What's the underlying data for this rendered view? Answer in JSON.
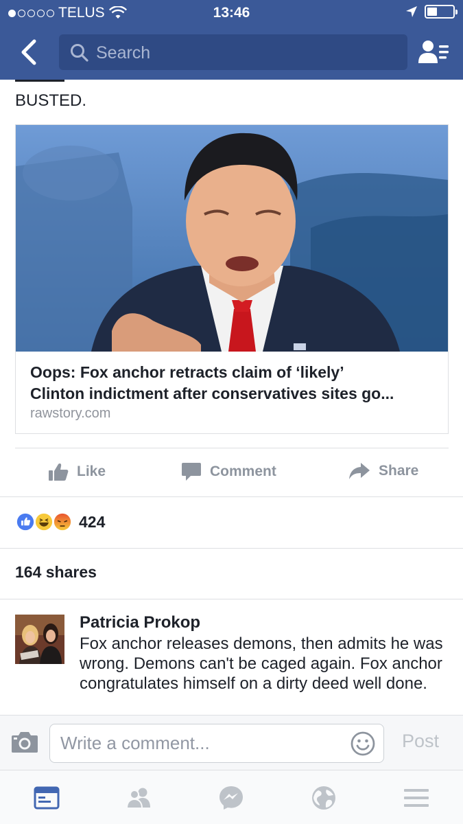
{
  "status_bar": {
    "carrier": "TELUS",
    "time": "13:46"
  },
  "header": {
    "search_placeholder": "Search"
  },
  "post": {
    "text": "BUSTED.",
    "link": {
      "title_line1": "Oops: Fox anchor retracts claim of ‘likely’",
      "title_line2": "Clinton indictment after conservatives sites go...",
      "domain": "rawstory.com"
    },
    "actions": {
      "like": "Like",
      "comment": "Comment",
      "share": "Share"
    },
    "reactions": {
      "icons": [
        "like-reaction-icon",
        "haha-reaction-icon",
        "angry-reaction-icon"
      ],
      "count": "424"
    },
    "shares": "164 shares"
  },
  "comment": {
    "author": "Patricia Prokop",
    "text": "Fox anchor releases demons, then admits he was wrong. Demons can't be caged again. Fox anchor congratulates himself on a dirty deed well done."
  },
  "composer": {
    "placeholder": "Write a comment...",
    "post_label": "Post"
  },
  "tab_bar": {
    "tabs": [
      "news-feed-icon",
      "friends-icon",
      "messenger-icon",
      "globe-icon",
      "menu-icon"
    ],
    "active": "news-feed-icon"
  },
  "colors": {
    "brand": "#3b5998",
    "active_tab": "#4267b2",
    "muted": "#8d949e"
  }
}
